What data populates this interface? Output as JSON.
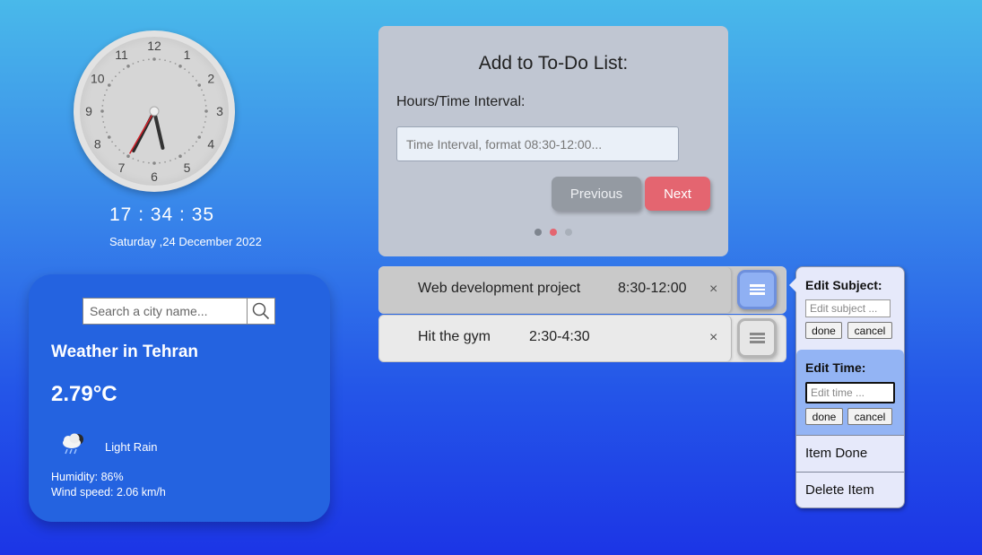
{
  "clock": {
    "numbers": [
      "12",
      "1",
      "2",
      "3",
      "4",
      "5",
      "6",
      "7",
      "8",
      "9",
      "10",
      "11"
    ],
    "hour": 17,
    "minute": 34,
    "second": 35,
    "digital": "17 : 34 : 35",
    "date": "Saturday ,24 December 2022"
  },
  "weather": {
    "search_placeholder": "Search a city name...",
    "title": "Weather in Tehran",
    "temperature": "2.79°C",
    "icon": "light-rain-icon",
    "description": "Light Rain",
    "humidity": "Humidity: 86%",
    "wind": "Wind speed: 2.06 km/h"
  },
  "todo_form": {
    "title": "Add to To-Do List:",
    "label": "Hours/Time Interval:",
    "input_placeholder": "Time Interval, format 08:30-12:00...",
    "prev_label": "Previous",
    "next_label": "Next",
    "steps_total": 3,
    "active_step": 2
  },
  "todo_items": [
    {
      "subject": "Web development project",
      "time": "8:30-12:00",
      "close": "×"
    },
    {
      "subject": "Hit the gym",
      "time": "2:30-4:30",
      "close": "×"
    }
  ],
  "item_menu": {
    "edit_subject_title": "Edit Subject:",
    "edit_subject_placeholder": "Edit subject ...",
    "edit_time_title": "Edit Time:",
    "edit_time_placeholder": "Edit time ...",
    "done_label": "done",
    "cancel_label": "cancel",
    "item_done": "Item Done",
    "delete_item": "Delete Item"
  },
  "colors": {
    "accent_red": "#e46570",
    "menu_active_blue": "#93b4f4",
    "second_hand": "#d0222a"
  }
}
